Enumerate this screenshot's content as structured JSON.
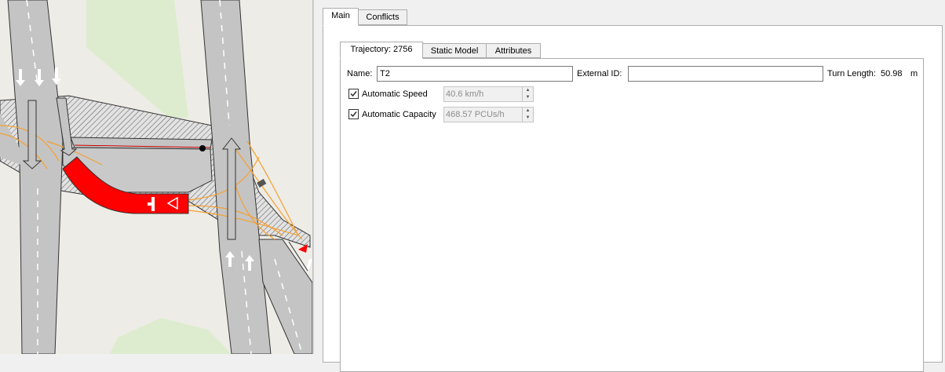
{
  "tabs": {
    "main": "Main",
    "conflicts": "Conflicts"
  },
  "subtabs": {
    "trajectory": "Trajectory: 2756",
    "static_model": "Static Model",
    "attributes": "Attributes"
  },
  "form": {
    "name_label": "Name:",
    "name_value": "T2",
    "external_id_label": "External ID:",
    "external_id_value": "",
    "turn_length_label": "Turn Length:",
    "turn_length_value": "50.98",
    "turn_length_unit": "m",
    "automatic_speed_label": "Automatic Speed",
    "automatic_speed_checked": true,
    "speed_value": "40.6 km/h",
    "automatic_capacity_label": "Automatic Capacity",
    "automatic_capacity_checked": true,
    "capacity_value": "468.57 PCUs/h"
  },
  "colors": {
    "selected_turn": "#ff0000",
    "turn_trajectories": "#f5a033",
    "road": "#c4c4c4",
    "background": "#eeece6",
    "green_area": "#d8ecc8"
  },
  "icons": {
    "checkbox": "check-icon",
    "spin": "spin-arrows-icon"
  }
}
